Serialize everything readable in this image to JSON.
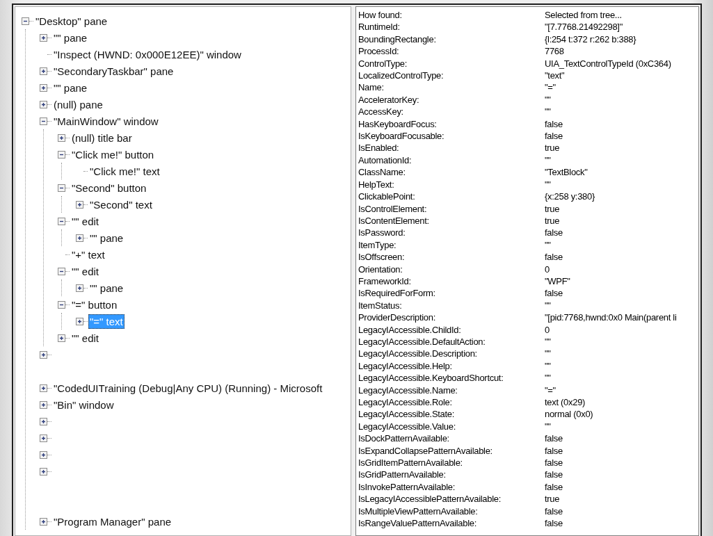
{
  "tree": [
    {
      "label": "\"Desktop\" pane",
      "expanded": true,
      "selected": false,
      "children": [
        {
          "label": "\"\" pane",
          "expanded": false,
          "selected": false
        },
        {
          "label": "\"Inspect  (HWND: 0x000E12EE)\" window",
          "selected": false
        },
        {
          "label": "\"SecondaryTaskbar\" pane",
          "expanded": false,
          "selected": false
        },
        {
          "label": "\"\" pane",
          "expanded": false,
          "selected": false
        },
        {
          "label": "(null) pane",
          "expanded": false,
          "selected": false
        },
        {
          "label": "\"MainWindow\" window",
          "expanded": true,
          "selected": false,
          "children": [
            {
              "label": "(null) title bar",
              "expanded": false,
              "selected": false
            },
            {
              "label": "\"Click me!\" button",
              "expanded": true,
              "selected": false,
              "children": [
                {
                  "label": "\"Click me!\" text",
                  "selected": false
                }
              ]
            },
            {
              "label": "\"Second\" button",
              "expanded": true,
              "selected": false,
              "children": [
                {
                  "label": "\"Second\" text",
                  "expanded": false,
                  "selected": false
                }
              ]
            },
            {
              "label": "\"\" edit",
              "expanded": true,
              "selected": false,
              "children": [
                {
                  "label": "\"\" pane",
                  "expanded": false,
                  "selected": false
                }
              ]
            },
            {
              "label": "\"+\" text",
              "selected": false
            },
            {
              "label": "\"\" edit",
              "expanded": true,
              "selected": false,
              "children": [
                {
                  "label": "\"\" pane",
                  "expanded": false,
                  "selected": false
                }
              ]
            },
            {
              "label": "\"=\" button",
              "expanded": true,
              "selected": false,
              "children": [
                {
                  "label": "\"=\" text",
                  "expanded": false,
                  "selected": true
                }
              ]
            },
            {
              "label": "\"\" edit",
              "expanded": false,
              "selected": false
            }
          ]
        },
        {
          "expanded": false
        },
        {
          "kind": "gap"
        },
        {
          "label": "\"CodedUITraining (Debug|Any CPU) (Running) - Microsoft",
          "expanded": false,
          "selected": false
        },
        {
          "label": "\"Bin\" window",
          "expanded": false,
          "selected": false
        },
        {
          "expanded": false
        },
        {
          "expanded": false
        },
        {
          "expanded": false
        },
        {
          "expanded": false
        },
        {
          "kind": "gap"
        },
        {
          "kind": "gap"
        },
        {
          "label": "\"Program Manager\" pane",
          "expanded": false,
          "selected": false
        }
      ]
    }
  ],
  "properties": [
    {
      "name": "How found:",
      "value": "Selected from tree..."
    },
    {
      "name": "RuntimeId:",
      "value": "\"[7.7768.21492298]\""
    },
    {
      "name": "BoundingRectangle:",
      "value": "{l:254 t:372 r:262 b:388}"
    },
    {
      "name": "ProcessId:",
      "value": "7768"
    },
    {
      "name": "ControlType:",
      "value": "UIA_TextControlTypeId (0xC364)"
    },
    {
      "name": "LocalizedControlType:",
      "value": "\"text\""
    },
    {
      "name": "Name:",
      "value": "\"=\""
    },
    {
      "name": "AcceleratorKey:",
      "value": "\"\""
    },
    {
      "name": "AccessKey:",
      "value": "\"\""
    },
    {
      "name": "HasKeyboardFocus:",
      "value": "false"
    },
    {
      "name": "IsKeyboardFocusable:",
      "value": "false"
    },
    {
      "name": "IsEnabled:",
      "value": "true"
    },
    {
      "name": "AutomationId:",
      "value": "\"\""
    },
    {
      "name": "ClassName:",
      "value": "\"TextBlock\""
    },
    {
      "name": "HelpText:",
      "value": "\"\""
    },
    {
      "name": "ClickablePoint:",
      "value": "{x:258 y:380}"
    },
    {
      "name": "IsControlElement:",
      "value": "true"
    },
    {
      "name": "IsContentElement:",
      "value": "true"
    },
    {
      "name": "IsPassword:",
      "value": "false"
    },
    {
      "name": "ItemType:",
      "value": "\"\""
    },
    {
      "name": "IsOffscreen:",
      "value": "false"
    },
    {
      "name": "Orientation:",
      "value": "0"
    },
    {
      "name": "FrameworkId:",
      "value": "\"WPF\""
    },
    {
      "name": "IsRequiredForForm:",
      "value": "false"
    },
    {
      "name": "ItemStatus:",
      "value": "\"\""
    },
    {
      "name": "ProviderDescription:",
      "value": "\"[pid:7768,hwnd:0x0 Main(parent li"
    },
    {
      "name": "LegacyIAccessible.ChildId:",
      "value": "0"
    },
    {
      "name": "LegacyIAccessible.DefaultAction:",
      "value": "\"\""
    },
    {
      "name": "LegacyIAccessible.Description:",
      "value": "\"\""
    },
    {
      "name": "LegacyIAccessible.Help:",
      "value": "\"\""
    },
    {
      "name": "LegacyIAccessible.KeyboardShortcut:",
      "value": "\"\""
    },
    {
      "name": "LegacyIAccessible.Name:",
      "value": "\"=\""
    },
    {
      "name": "LegacyIAccessible.Role:",
      "value": "text (0x29)"
    },
    {
      "name": "LegacyIAccessible.State:",
      "value": "normal (0x0)"
    },
    {
      "name": "LegacyIAccessible.Value:",
      "value": "\"\""
    },
    {
      "name": "IsDockPatternAvailable:",
      "value": "false"
    },
    {
      "name": "IsExpandCollapsePatternAvailable:",
      "value": "false"
    },
    {
      "name": "IsGridItemPatternAvailable:",
      "value": "false"
    },
    {
      "name": "IsGridPatternAvailable:",
      "value": "false"
    },
    {
      "name": "IsInvokePatternAvailable:",
      "value": "false"
    },
    {
      "name": "IsLegacyIAccessiblePatternAvailable:",
      "value": "true"
    },
    {
      "name": "IsMultipleViewPatternAvailable:",
      "value": "false"
    },
    {
      "name": "IsRangeValuePatternAvailable:",
      "value": "false"
    }
  ]
}
